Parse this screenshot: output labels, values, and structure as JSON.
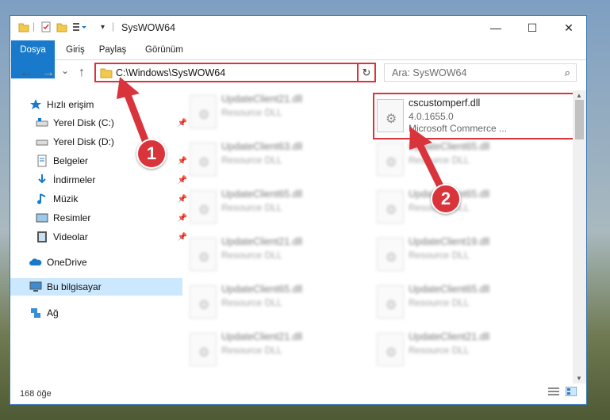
{
  "window": {
    "title": "SysWOW64",
    "quick_access_toolbar": [
      "folder-icon",
      "properties-icon",
      "new-folder-icon",
      "customize-icon"
    ],
    "controls": {
      "minimize": "—",
      "maximize": "☐",
      "close": "✕"
    }
  },
  "ribbon": {
    "tabs": [
      "Dosya",
      "Giriş",
      "Paylaş",
      "Görünüm"
    ]
  },
  "navigation": {
    "back": "←",
    "forward": "→",
    "recent": "⌄",
    "up": "↑",
    "address": "C:\\Windows\\SysWOW64",
    "dropdown": "⌄",
    "refresh": "↻",
    "search_placeholder": "Ara: SysWOW64",
    "search_icon": "⌕"
  },
  "sidebar": {
    "items": [
      {
        "label": "Hızlı erişim",
        "icon": "star-icon",
        "pinned": false
      },
      {
        "label": "Yerel Disk (C:)",
        "icon": "drive-icon",
        "pinned": true
      },
      {
        "label": "Yerel Disk (D:)",
        "icon": "drive-icon",
        "pinned": false
      },
      {
        "label": "Belgeler",
        "icon": "documents-icon",
        "pinned": true
      },
      {
        "label": "İndirmeler",
        "icon": "download-icon",
        "pinned": true
      },
      {
        "label": "Müzik",
        "icon": "music-icon",
        "pinned": true
      },
      {
        "label": "Resimler",
        "icon": "pictures-icon",
        "pinned": true
      },
      {
        "label": "Videolar",
        "icon": "video-icon",
        "pinned": true
      },
      {
        "label": "OneDrive",
        "icon": "cloud-icon",
        "pinned": false
      },
      {
        "label": "Bu bilgisayar",
        "icon": "computer-icon",
        "pinned": false,
        "selected": true
      },
      {
        "label": "Ağ",
        "icon": "network-icon",
        "pinned": false
      }
    ]
  },
  "files": {
    "left_column": [
      {
        "name": "UpdateClient21.dll",
        "desc": "Resource DLL"
      },
      {
        "name": "UpdateClient63.dll",
        "desc": "Resource DLL"
      },
      {
        "name": "UpdateClient65.dll",
        "desc": "Resource DLL"
      },
      {
        "name": "UpdateClient21.dll",
        "desc": "Resource DLL"
      },
      {
        "name": "UpdateClient65.dll",
        "desc": "Resource DLL"
      },
      {
        "name": "UpdateClient21.dll",
        "desc": "Resource DLL"
      }
    ],
    "right_column_top": {
      "name": "cscustomperf.dll",
      "version": "4.0.1655.0",
      "company": "Microsoft Commerce ..."
    },
    "right_column": [
      {
        "name": "UpdateClient65.dll",
        "desc": "Resource DLL"
      },
      {
        "name": "UpdateClient65.dll",
        "desc": "Resource DLL"
      },
      {
        "name": "UpdateClient19.dll",
        "desc": "Resource DLL"
      },
      {
        "name": "UpdateClient65.dll",
        "desc": "Resource DLL"
      },
      {
        "name": "UpdateClient21.dll",
        "desc": "Resource DLL"
      }
    ]
  },
  "status": {
    "count": "168 öğe"
  },
  "callouts": {
    "first": "1",
    "second": "2"
  },
  "colors": {
    "accent": "#1979ca",
    "highlight": "#d9333c",
    "selection": "#cce8ff"
  }
}
